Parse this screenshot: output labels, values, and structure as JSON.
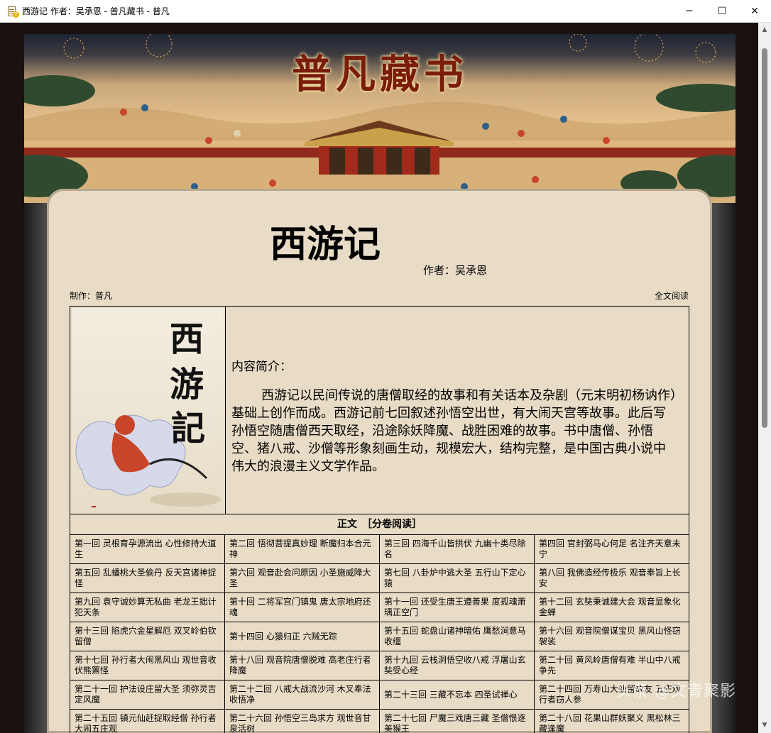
{
  "window": {
    "title": "西游记 作者：吴承恩 - 普凡藏书 - 普凡",
    "minimize": "─",
    "maximize": "☐",
    "close": "✕"
  },
  "banner": {
    "title": "普凡藏书"
  },
  "book": {
    "title": "西游记",
    "author": "作者：吴承恩",
    "maker": "制作：普凡",
    "full_read": "全文阅读",
    "cover_chars": [
      "西",
      "游",
      "記"
    ],
    "intro_label": "内容简介：",
    "intro": "西游记以民间传说的唐僧取经的故事和有关话本及杂剧（元末明初杨讷作）基础上创作而成。西游记前七回叙述孙悟空出世，有大闹天宫等故事。此后写孙悟空随唐僧西天取经，沿途除妖降魔、战胜困难的故事。书中唐僧、孙悟空、猪八戒、沙僧等形象刻画生动，规模宏大，结构完整，是中国古典小说中伟大的浪漫主义文学作品。"
  },
  "toc": {
    "header": "正文　［分卷阅读］",
    "chapters": [
      "第一回 灵根育孕源流出 心性修持大道生",
      "第二回 悟彻菩提真妙理 断魔归本合元神",
      "第三回 四海千山皆拱伏 九幽十类尽除名",
      "第四回 官封弼马心何足 名注齐天意未宁",
      "第五回 乱蟠桃大圣偷丹 反天宫诸神捉怪",
      "第六回 观音赴会问原因 小圣施威降大圣",
      "第七回 八卦炉中逃大圣 五行山下定心猿",
      "第八回 我佛造经传极乐 观音奉旨上长安",
      "第九回 袁守诚妙算无私曲 老龙王拙计犯天条",
      "第十回 二将军宫门镇鬼 唐太宗地府还魂",
      "第十一回 还受生唐王遵善果 度孤魂萧瑀正空门",
      "第十二回 玄奘秉诚建大会 观音显象化金蝉",
      "第十三回 陷虎穴金星解厄 双叉岭伯钦留僧",
      "第十四回 心猿归正 六贼无踪",
      "第十五回 蛇盘山诸神暗佑 鹰愁涧意马收缰",
      "第十六回 观音院僧谋宝贝 黑风山怪窃袈裟",
      "第十七回 孙行者大闹黑风山 观世音收伏熊罴怪",
      "第十八回 观音院唐僧脱难 高老庄行者降魔",
      "第十九回 云栈洞悟空收八戒 浮屠山玄奘受心经",
      "第二十回 黄风岭唐僧有难 半山中八戒争先",
      "第二十一回 护法设庄留大圣 须弥灵吉定风魔",
      "第二十二回 八戒大战流沙河 木叉奉法收悟净",
      "第二十三回 三藏不忘本 四圣试禅心",
      "第二十四回 万寿山大仙留故友 五庄观行者窃人参",
      "第二十五回 镇元仙赶捉取经僧 孙行者大闹五庄观",
      "第二十六回 孙悟空三岛求方 观世音甘泉活树",
      "第二十七回 尸魔三戏唐三藏 圣僧恨逐美猴王",
      "第二十八回 花果山群妖聚义 黑松林三藏逢魔"
    ]
  },
  "watermark": "头条 @文青聚影"
}
